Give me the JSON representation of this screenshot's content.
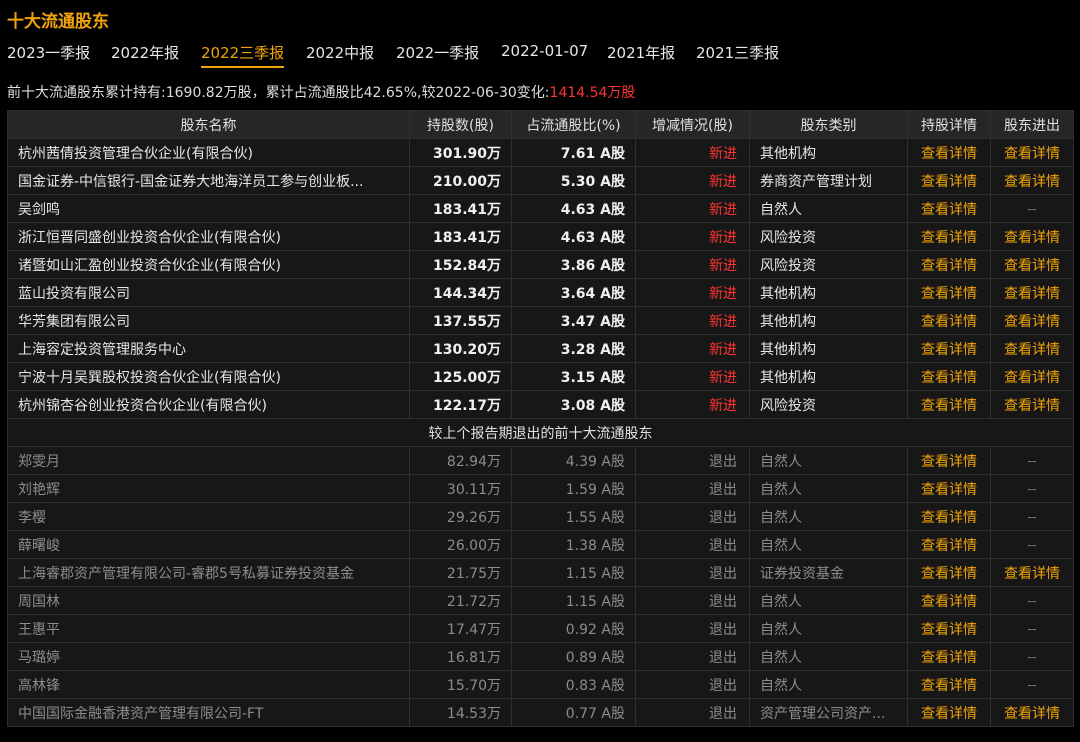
{
  "title": "十大流通股东",
  "tabs": [
    {
      "label": "2023一季报",
      "active": false
    },
    {
      "label": "2022年报",
      "active": false
    },
    {
      "label": "2022三季报",
      "active": true
    },
    {
      "label": "2022中报",
      "active": false
    },
    {
      "label": "2022一季报",
      "active": false
    },
    {
      "label": "2022-01-07",
      "active": false
    },
    {
      "label": "2021年报",
      "active": false
    },
    {
      "label": "2021三季报",
      "active": false
    }
  ],
  "summary": {
    "text": "前十大流通股东累计持有:1690.82万股，累计占流通股比42.65%,较2022-06-30变化:",
    "change": "1414.54万股"
  },
  "headers": [
    "股东名称",
    "持股数(股)",
    "占流通股比(%)",
    "增减情况(股)",
    "股东类别",
    "持股详情",
    "股东进出"
  ],
  "rows": [
    {
      "name": "杭州茜倩投资管理合伙企业(有限合伙)",
      "shares": "301.90万",
      "ratio": "7.61 A股",
      "change": "新进",
      "type": "其他机构",
      "detail": "查看详情",
      "inout": "查看详情"
    },
    {
      "name": "国金证券-中信银行-国金证券大地海洋员工参与创业板...",
      "shares": "210.00万",
      "ratio": "5.30 A股",
      "change": "新进",
      "type": "券商资产管理计划",
      "detail": "查看详情",
      "inout": "查看详情"
    },
    {
      "name": "吴剑鸣",
      "shares": "183.41万",
      "ratio": "4.63 A股",
      "change": "新进",
      "type": "自然人",
      "detail": "查看详情",
      "inout": "--"
    },
    {
      "name": "浙江恒晋同盛创业投资合伙企业(有限合伙)",
      "shares": "183.41万",
      "ratio": "4.63 A股",
      "change": "新进",
      "type": "风险投资",
      "detail": "查看详情",
      "inout": "查看详情"
    },
    {
      "name": "诸暨如山汇盈创业投资合伙企业(有限合伙)",
      "shares": "152.84万",
      "ratio": "3.86 A股",
      "change": "新进",
      "type": "风险投资",
      "detail": "查看详情",
      "inout": "查看详情"
    },
    {
      "name": "蓝山投资有限公司",
      "shares": "144.34万",
      "ratio": "3.64 A股",
      "change": "新进",
      "type": "其他机构",
      "detail": "查看详情",
      "inout": "查看详情"
    },
    {
      "name": "华芳集团有限公司",
      "shares": "137.55万",
      "ratio": "3.47 A股",
      "change": "新进",
      "type": "其他机构",
      "detail": "查看详情",
      "inout": "查看详情"
    },
    {
      "name": "上海容定投资管理服务中心",
      "shares": "130.20万",
      "ratio": "3.28 A股",
      "change": "新进",
      "type": "其他机构",
      "detail": "查看详情",
      "inout": "查看详情"
    },
    {
      "name": "宁波十月吴巽股权投资合伙企业(有限合伙)",
      "shares": "125.00万",
      "ratio": "3.15 A股",
      "change": "新进",
      "type": "其他机构",
      "detail": "查看详情",
      "inout": "查看详情"
    },
    {
      "name": "杭州锦杏谷创业投资合伙企业(有限合伙)",
      "shares": "122.17万",
      "ratio": "3.08 A股",
      "change": "新进",
      "type": "风险投资",
      "detail": "查看详情",
      "inout": "查看详情"
    }
  ],
  "exit_section_label": "较上个报告期退出的前十大流通股东",
  "exit_rows": [
    {
      "name": "郑雯月",
      "shares": "82.94万",
      "ratio": "4.39 A股",
      "change": "退出",
      "type": "自然人",
      "detail": "查看详情",
      "inout": "--"
    },
    {
      "name": "刘艳辉",
      "shares": "30.11万",
      "ratio": "1.59 A股",
      "change": "退出",
      "type": "自然人",
      "detail": "查看详情",
      "inout": "--"
    },
    {
      "name": "李樱",
      "shares": "29.26万",
      "ratio": "1.55 A股",
      "change": "退出",
      "type": "自然人",
      "detail": "查看详情",
      "inout": "--"
    },
    {
      "name": "薛曙峻",
      "shares": "26.00万",
      "ratio": "1.38 A股",
      "change": "退出",
      "type": "自然人",
      "detail": "查看详情",
      "inout": "--"
    },
    {
      "name": "上海睿郡资产管理有限公司-睿郡5号私募证券投资基金",
      "shares": "21.75万",
      "ratio": "1.15 A股",
      "change": "退出",
      "type": "证券投资基金",
      "detail": "查看详情",
      "inout": "查看详情"
    },
    {
      "name": "周国林",
      "shares": "21.72万",
      "ratio": "1.15 A股",
      "change": "退出",
      "type": "自然人",
      "detail": "查看详情",
      "inout": "--"
    },
    {
      "name": "王惠平",
      "shares": "17.47万",
      "ratio": "0.92 A股",
      "change": "退出",
      "type": "自然人",
      "detail": "查看详情",
      "inout": "--"
    },
    {
      "name": "马璐婷",
      "shares": "16.81万",
      "ratio": "0.89 A股",
      "change": "退出",
      "type": "自然人",
      "detail": "查看详情",
      "inout": "--"
    },
    {
      "name": "高林锋",
      "shares": "15.70万",
      "ratio": "0.83 A股",
      "change": "退出",
      "type": "自然人",
      "detail": "查看详情",
      "inout": "--"
    },
    {
      "name": "中国国际金融香港资产管理有限公司-FT",
      "shares": "14.53万",
      "ratio": "0.77 A股",
      "change": "退出",
      "type": "资产管理公司资产...",
      "detail": "查看详情",
      "inout": "查看详情"
    }
  ]
}
